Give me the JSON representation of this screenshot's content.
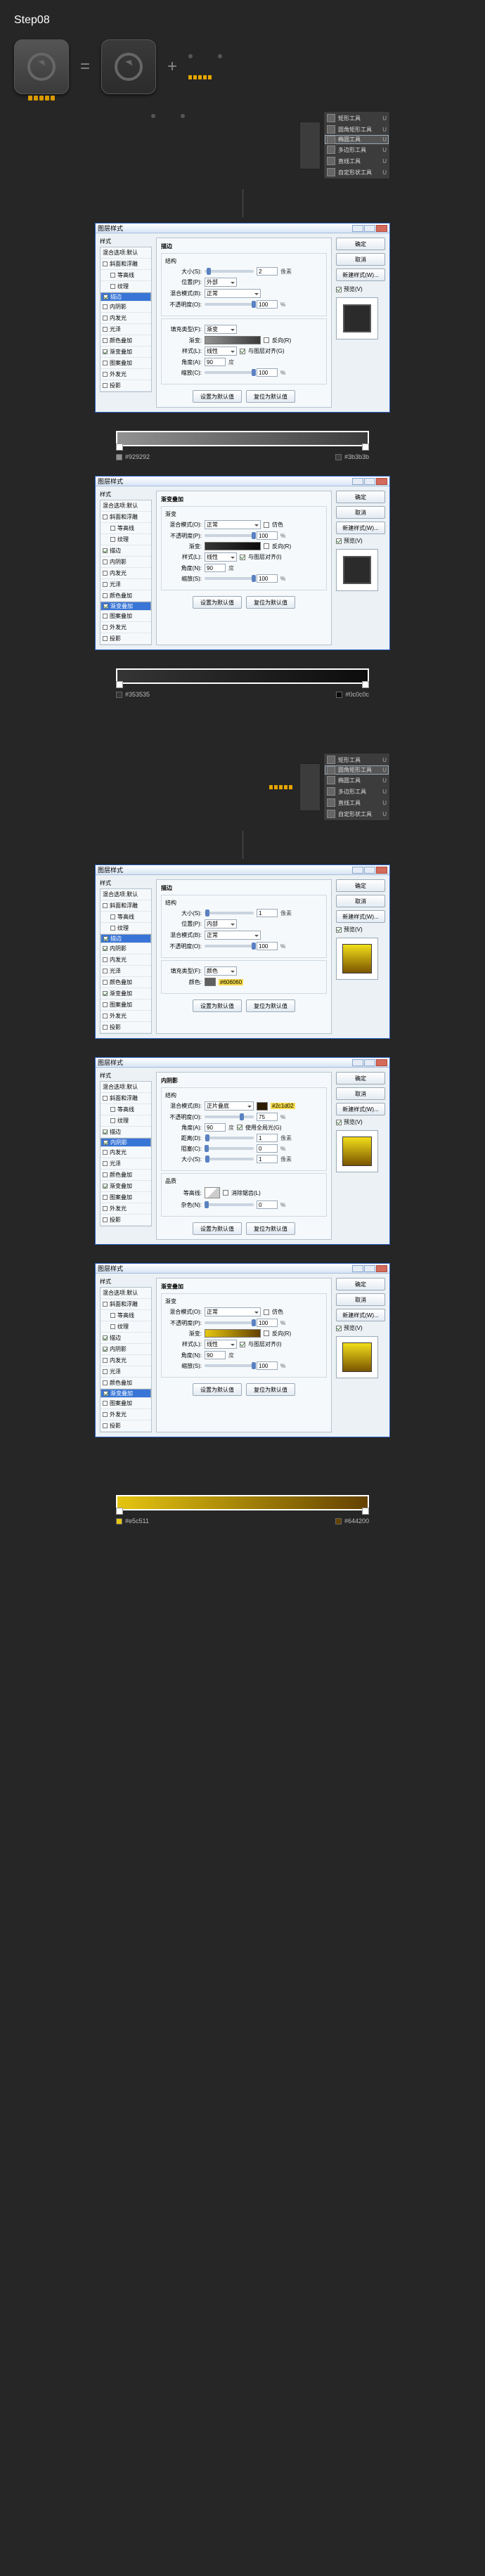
{
  "step_heading": "Step08",
  "op_equals": "=",
  "op_plus": "+",
  "toolfly": {
    "items": [
      {
        "label": "矩形工具",
        "key": "U"
      },
      {
        "label": "圆角矩形工具",
        "key": "U"
      },
      {
        "label": "椭圆工具",
        "key": "U"
      },
      {
        "label": "多边形工具",
        "key": "U"
      },
      {
        "label": "直线工具",
        "key": "U"
      },
      {
        "label": "自定形状工具",
        "key": "U"
      }
    ]
  },
  "dialog_title": "图层样式",
  "style_head": "样式",
  "style_sub": "混合选项:默认",
  "styles": {
    "bevel": "斜面和浮雕",
    "contour": "等高线",
    "texture": "纹理",
    "stroke": "描边",
    "innerShadow": "内阴影",
    "innerGlow": "内发光",
    "satin": "光泽",
    "colorOverlay": "颜色叠加",
    "gradOverlay": "渐变叠加",
    "patOverlay": "图案叠加",
    "outerGlow": "外发光",
    "dropShadow": "投影"
  },
  "buttons": {
    "ok": "确定",
    "cancel": "取消",
    "newStyle": "新建样式(W)...",
    "preview": "预览(V)",
    "defaults": "设置为默认值",
    "reset": "复位为默认值"
  },
  "stroke": {
    "section": "描边",
    "structLabel": "结构",
    "size": "大小(S):",
    "sizeVal": "2",
    "sizeUnit": "像素",
    "position": "位置(P):",
    "positionVal": "外部",
    "blend": "混合模式(B):",
    "blendVal": "正常",
    "opacity": "不透明度(O):",
    "opacityVal": "100",
    "pct": "%",
    "fillTypeLabel": "填充类型(F):",
    "fillTypeVal": "渐变",
    "grad": "渐变:",
    "reverse": "反向(R)",
    "styleLabel": "样式(L):",
    "styleVal": "线性",
    "align": "与图层对齐(G)",
    "angle": "角度(A):",
    "angleVal": "90",
    "deg": "度",
    "scale": "缩放(C):",
    "scaleVal": "100"
  },
  "stroke2": {
    "section": "描边",
    "sizeVal": "1",
    "positionVal": "内部",
    "blendVal": "正常",
    "opacityVal": "100",
    "fillTypeVal": "颜色",
    "colorLabel": "颜色:",
    "hex": "#606060"
  },
  "grad_overlay": {
    "section": "渐变叠加",
    "gradLabel": "渐变",
    "blend": "混合模式(O):",
    "blendVal": "正常",
    "dither": "仿色",
    "opacity": "不透明度(P):",
    "opacityVal": "100",
    "grad": "渐变:",
    "reverse": "反向(R)",
    "styleLabel": "样式(L):",
    "styleVal": "线性",
    "align": "与图层对齐(I)",
    "angle": "角度(N):",
    "angleVal": "90",
    "deg": "度",
    "scale": "缩放(S):",
    "scaleVal": "100"
  },
  "inner_shadow": {
    "section": "内阴影",
    "structLabel": "结构",
    "blend": "混合模式(B):",
    "blendVal": "正片叠底",
    "hex": "#2c1d02",
    "opacity": "不透明度(O):",
    "opacityVal": "75",
    "angle": "角度(A):",
    "angleVal": "90",
    "deg": "度",
    "global": "使用全局光(G)",
    "distance": "距离(D):",
    "distanceVal": "1",
    "px": "像素",
    "choke": "阻塞(C):",
    "chokeVal": "0",
    "pct": "%",
    "size": "大小(S):",
    "sizeVal": "1",
    "quality": "品质",
    "contour": "等高线:",
    "anti": "消除锯齿(L)",
    "noise": "杂色(N):",
    "noiseVal": "0"
  },
  "swatches": {
    "g1a": "#929292",
    "g1b": "#3b3b3b",
    "g2a": "#353535",
    "g2b": "#0c0c0c",
    "g3a": "#e5c511",
    "g3b": "#644200"
  },
  "dots_label": ""
}
